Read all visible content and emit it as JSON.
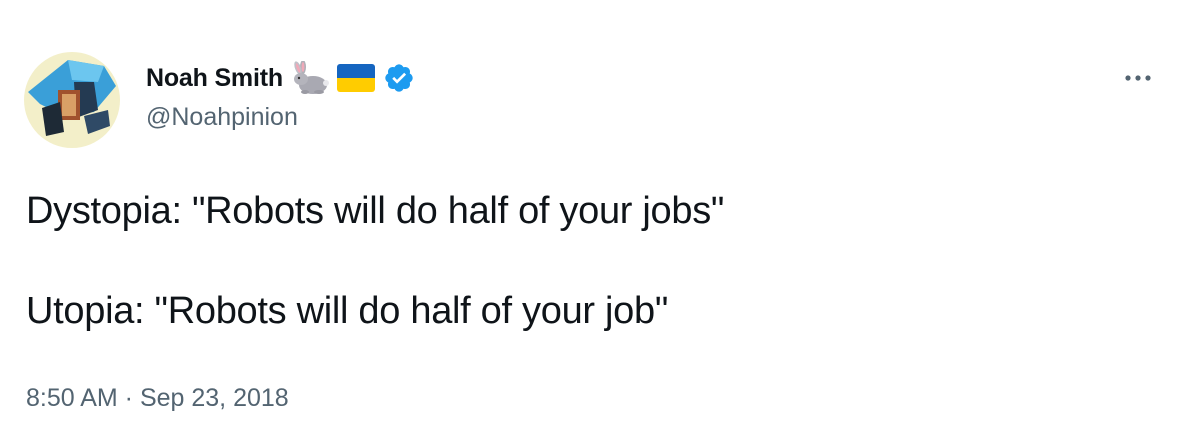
{
  "tweet": {
    "author": {
      "display_name": "Noah Smith",
      "handle": "@Noahpinion",
      "name_emojis": [
        "rabbit-icon",
        "ukraine-flag-icon",
        "verified-badge-icon"
      ],
      "verified_color": "#1d9bf0"
    },
    "text_lines": [
      "Dystopia: \"Robots will do half of your jobs\"",
      "Utopia: \"Robots will do half of your job\""
    ],
    "timestamp": "8:50 AM · Sep 23, 2018"
  },
  "colors": {
    "text_primary": "#0f1419",
    "text_secondary": "#536471",
    "accent": "#1d9bf0"
  }
}
